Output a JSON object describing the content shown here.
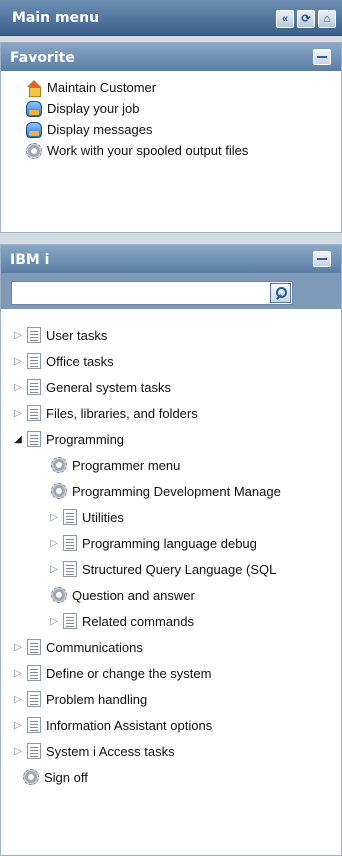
{
  "main_header": {
    "title": "Main menu",
    "buttons": [
      {
        "label": "«",
        "icon": "collapse-left-icon"
      },
      {
        "label": "⟳",
        "icon": "refresh-icon"
      },
      {
        "label": "⌂",
        "icon": "home-icon"
      }
    ]
  },
  "favorite": {
    "title": "Favorite",
    "items": [
      {
        "label": "Maintain Customer",
        "icon": "house-icon"
      },
      {
        "label": "Display your job",
        "icon": "job-icon"
      },
      {
        "label": "Display messages",
        "icon": "messages-icon"
      },
      {
        "label": "Work with your spooled output files",
        "icon": "gear-icon"
      }
    ]
  },
  "ibm": {
    "title": "IBM i",
    "search": {
      "placeholder": "",
      "value": ""
    },
    "tree": [
      {
        "label": "User tasks",
        "level": 0,
        "state": "collapsed",
        "icon": "doc-icon"
      },
      {
        "label": "Office tasks",
        "level": 0,
        "state": "collapsed",
        "icon": "doc-icon"
      },
      {
        "label": "General system tasks",
        "level": 0,
        "state": "collapsed",
        "icon": "doc-icon"
      },
      {
        "label": "Files, libraries, and folders",
        "level": 0,
        "state": "collapsed",
        "icon": "doc-icon"
      },
      {
        "label": "Programming",
        "level": 0,
        "state": "expanded",
        "icon": "doc-icon"
      },
      {
        "label": "Programmer menu",
        "level": 1,
        "state": "leaf",
        "icon": "gear-icon"
      },
      {
        "label": "Programming Development Manage",
        "level": 1,
        "state": "leaf",
        "icon": "gear-icon"
      },
      {
        "label": "Utilities",
        "level": 1,
        "state": "collapsed",
        "icon": "doc-icon"
      },
      {
        "label": "Programming language debug",
        "level": 1,
        "state": "collapsed",
        "icon": "doc-icon"
      },
      {
        "label": "Structured Query Language (SQL",
        "level": 1,
        "state": "collapsed",
        "icon": "doc-icon"
      },
      {
        "label": "Question and answer",
        "level": 1,
        "state": "leaf",
        "icon": "gear-icon"
      },
      {
        "label": "Related commands",
        "level": 1,
        "state": "collapsed",
        "icon": "doc-icon"
      },
      {
        "label": "Communications",
        "level": 0,
        "state": "collapsed",
        "icon": "doc-icon"
      },
      {
        "label": "Define or change the system",
        "level": 0,
        "state": "collapsed",
        "icon": "doc-icon"
      },
      {
        "label": "Problem handling",
        "level": 0,
        "state": "collapsed",
        "icon": "doc-icon"
      },
      {
        "label": "Information Assistant options",
        "level": 0,
        "state": "collapsed",
        "icon": "doc-icon"
      },
      {
        "label": "System i Access tasks",
        "level": 0,
        "state": "collapsed",
        "icon": "doc-icon"
      },
      {
        "label": "Sign off",
        "level": 0,
        "state": "leaf",
        "icon": "gear-icon"
      }
    ]
  }
}
